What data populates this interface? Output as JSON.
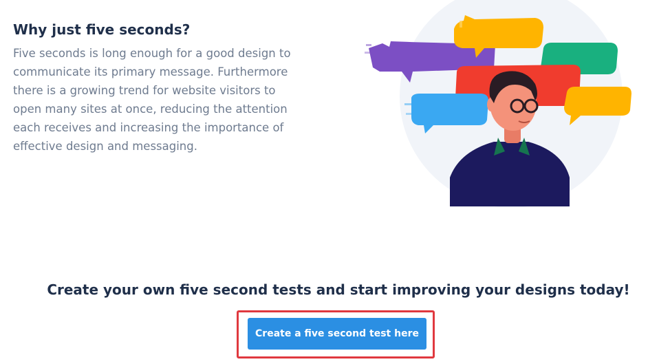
{
  "intro": {
    "heading": "Why just five seconds?",
    "body": "Five seconds is long enough for a good design to communicate its primary message. Furthermore there is a growing trend for website visitors to open many sites at once, reducing the attention each receives and increasing the importance of effective design and messaging."
  },
  "illustration": {
    "subject": "person with speech bubbles",
    "colors": {
      "background_circle": "#f1f4f9",
      "purple_bubble": "#7c4fc4",
      "yellow_bubble": "#ffb400",
      "green_bubble": "#19b07f",
      "red_bubble": "#f03c2e",
      "blue_bubble": "#3aa8f2",
      "shirt": "#1c1a5e",
      "skin": "#f4927a",
      "hair": "#2a1c24"
    }
  },
  "cta": {
    "heading": "Create your own five second tests and start improving your designs today!",
    "button_label": "Create a five second test here",
    "button_color": "#2b8fe3",
    "highlight_color": "#e0393f"
  }
}
